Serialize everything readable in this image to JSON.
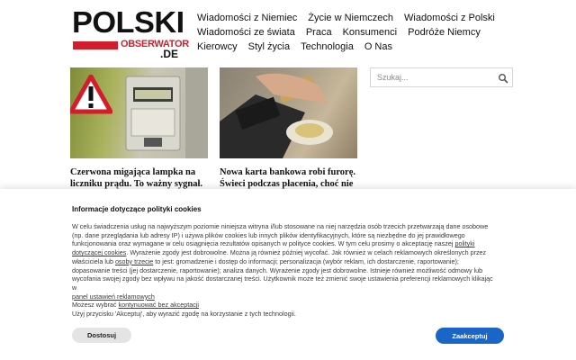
{
  "logo": {
    "word": "POLSKI",
    "sub": "OBSERWATOR",
    "tld": ".DE",
    "brand_red": "#d31d2a"
  },
  "nav": {
    "row1": [
      "Wiadomości z Niemiec",
      "Życie w Niemczech",
      "Wiadomości z Polski"
    ],
    "row2": [
      "Wiadomości ze świata",
      "Praca",
      "Konsumenci",
      "Podróże Niemcy"
    ],
    "row3": [
      "Kierowcy",
      "Styl życia",
      "Technologia",
      "O Nas"
    ]
  },
  "search": {
    "placeholder": "Szukaj...",
    "icon": "search-icon"
  },
  "articles": [
    {
      "title": "Czerwona migająca lampka na liczniku prądu. To ważny sygnał.",
      "image_icon": "warning-triangle-icon"
    },
    {
      "title": "Nowa karta bankowa robi furorę. Świeci podczas płacenia, choć nie",
      "image_icon": "payment-terminal-icon"
    }
  ],
  "cookie": {
    "title": "Informacje dotyczące polityki cookies",
    "p1": "W celu świadczenia usług na najwyższym poziomie niniejsza witryna i/lub stosowane na niej narzędzia osób trzecich przetwarzają dane osobowe (np. dane przeglądania lub adresy IP) i używa plików cookies lub innych plików identyfikacyjnych, które są niezbędne do jej prawidłowego funkcjonowania oraz wymagane w celu osiągnięcia rezultatów opisanych w polityce cookies. W tym celu prosimy o akceptację naszej ",
    "link_policy": "polityki dotyczącej cookies",
    "p2": ". Wyrażenie zgody jest dobrowolne. Można ją również później wycofać. Jak również w celach reklamowych określonych przez właściciela lub ",
    "link_third": "osoby trzecie",
    "p3": " to jest: gromadzenie i dostęp do informacji; personalizacja (wybór reklam, ich dostarczenie, raportowanie); dopasowanie treści (jej dostarczenie, raportowanie); analiza danych. Wyrażenie zgody jest dobrowolne. Istnieje również możliwość odmowy lub wycofania swojej zgody bez wpływu na jakość dostarczanej treści. Użytkownik może też zmienić swoje ustawienia preferencji reklamowych klikając w ",
    "link_panel": "panel ustawień reklamowych",
    "p4_before": "Możesz wybrać ",
    "link_continue": "kontynuować bez akceptacji",
    "p5": "Użyj przycisku 'Akceptuj', aby wyrazić zgodę na korzystanie z tych technologii.",
    "btn_settings": "Dostosuj",
    "btn_accept": "Zaakceptuj",
    "accent": "#1a66c7"
  }
}
